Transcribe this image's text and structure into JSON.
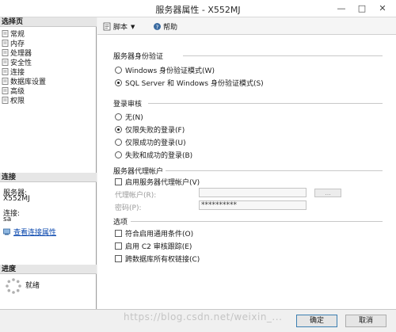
{
  "window": {
    "title": "服务器属性 - X552MJ"
  },
  "left_pane": {
    "select_page_header": "选择页",
    "nav_items": [
      {
        "label": "常规",
        "icon": "page-icon"
      },
      {
        "label": "内存",
        "icon": "page-icon"
      },
      {
        "label": "处理器",
        "icon": "page-icon"
      },
      {
        "label": "安全性",
        "icon": "page-icon"
      },
      {
        "label": "连接",
        "icon": "page-icon"
      },
      {
        "label": "数据库设置",
        "icon": "page-icon"
      },
      {
        "label": "高级",
        "icon": "page-icon"
      },
      {
        "label": "权限",
        "icon": "page-icon"
      }
    ],
    "connection_header": "连接",
    "server_label": "服务器:",
    "server_value": "X552MJ",
    "connection_label": "连接:",
    "connection_value": "sa",
    "view_connection_link": "查看连接属性",
    "progress_header": "进度",
    "progress_status": "就绪"
  },
  "toolbar": {
    "script_label": "脚本",
    "help_label": "帮助"
  },
  "auth": {
    "group_title": "服务器身份验证",
    "options": [
      {
        "label": "Windows 身份验证模式(W)",
        "selected": false
      },
      {
        "label": "SQL Server 和 Windows 身份验证模式(S)",
        "selected": true
      }
    ]
  },
  "audit": {
    "group_title": "登录审核",
    "options": [
      {
        "label": "无(N)",
        "selected": false
      },
      {
        "label": "仅限失败的登录(F)",
        "selected": true
      },
      {
        "label": "仅限成功的登录(U)",
        "selected": false
      },
      {
        "label": "失败和成功的登录(B)",
        "selected": false
      }
    ]
  },
  "proxy": {
    "group_title": "服务器代理帐户",
    "enable_label": "启用服务器代理帐户(V)",
    "enabled": false,
    "account_label": "代理帐户(R):",
    "account_value": "",
    "password_label": "密码(P):",
    "password_value": "**********",
    "browse_label": "..."
  },
  "options_group": {
    "group_title": "选项",
    "items": [
      {
        "label": "符合启用通用条件(O)",
        "checked": false
      },
      {
        "label": "启用 C2 审核跟踪(E)",
        "checked": false
      },
      {
        "label": "跨数据库所有权链接(C)",
        "checked": false
      }
    ]
  },
  "buttons": {
    "ok": "确定",
    "cancel": "取消"
  },
  "watermark": "https://blog.csdn.net/weixin_..."
}
